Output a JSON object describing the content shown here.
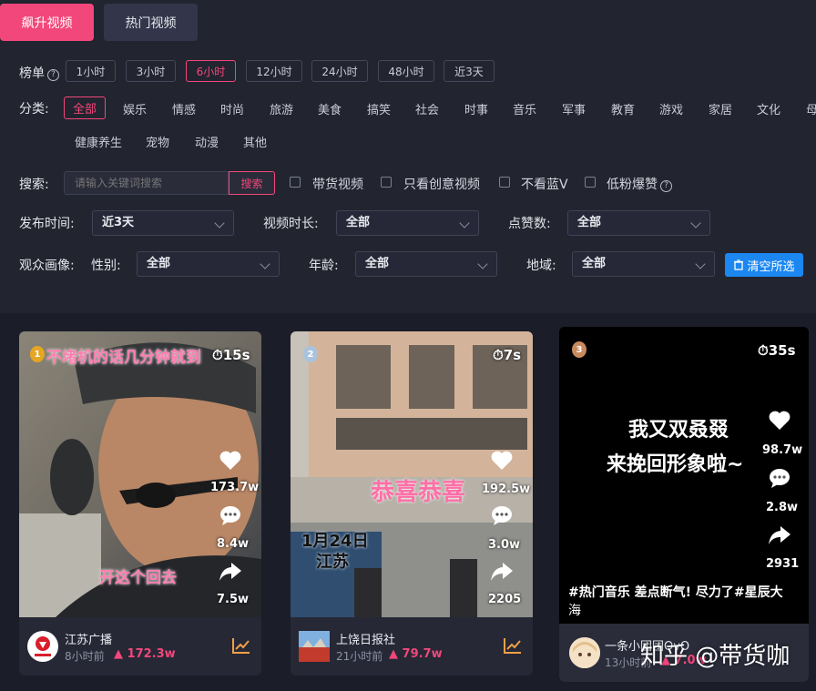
{
  "top_tabs": [
    {
      "label": "飙升视频",
      "active": true
    },
    {
      "label": "热门视频",
      "active": false
    }
  ],
  "filters": {
    "rank_label": "榜单",
    "rank_pills": [
      "1小时",
      "3小时",
      "6小时",
      "12小时",
      "24小时",
      "48小时",
      "近3天"
    ],
    "rank_active": "6小时",
    "category_label": "分类:",
    "categories_row1": [
      "全部",
      "娱乐",
      "情感",
      "时尚",
      "旅游",
      "美食",
      "搞笑",
      "社会",
      "时事",
      "音乐",
      "军事",
      "教育",
      "游戏",
      "家居",
      "文化",
      "母"
    ],
    "categories_row2": [
      "健康养生",
      "宠物",
      "动漫",
      "其他"
    ],
    "category_active": "全部",
    "search_label": "搜索:",
    "search_placeholder": "请输入关键词搜索",
    "search_button": "搜索",
    "checkboxes": [
      "带货视频",
      "只看创意视频",
      "不看蓝V",
      "低粉爆赞"
    ],
    "publish_time_label": "发布时间:",
    "publish_time_value": "近3天",
    "duration_label": "视频时长:",
    "duration_value": "全部",
    "likes_label": "点赞数:",
    "likes_value": "全部",
    "audience_label": "观众画像:",
    "gender_label": "性别:",
    "gender_value": "全部",
    "age_label": "年龄:",
    "age_value": "全部",
    "region_label": "地域:",
    "region_value": "全部",
    "clear_button": "清空所选"
  },
  "cards": [
    {
      "rank": "1",
      "duration": "15s",
      "overlay_top": "不堵机的话几分钟就到",
      "overlay_mid": "开这个回去",
      "likes": "173.7w",
      "comments": "8.4w",
      "shares": "7.5w",
      "author": "江苏广播",
      "time_ago": "8小时前",
      "growth": "172.3w"
    },
    {
      "rank": "2",
      "duration": "7s",
      "overlay_top": "恭喜恭喜",
      "overlay_date": "1月24日",
      "overlay_place": "江苏",
      "likes": "192.5w",
      "comments": "3.0w",
      "shares": "2205",
      "author": "上饶日报社",
      "time_ago": "21小时前",
      "growth": "79.7w"
    },
    {
      "rank": "3",
      "duration": "35s",
      "overlay_line1": "我又双叒叕",
      "overlay_line2": "来挽回形象啦~",
      "likes": "98.7w",
      "comments": "2.8w",
      "shares": "2931",
      "caption_line1": "#热门音乐 差点断气! 尽力了#星辰大",
      "caption_line2": "海",
      "author": "一条小团团OvO",
      "time_ago": "13小时前",
      "growth": "7.0w"
    }
  ],
  "watermark": "知乎 @带货咖",
  "colors": {
    "accent": "#f2477a",
    "blue": "#1c87f0",
    "bg": "#1b1d29",
    "panel": "#22242f"
  }
}
